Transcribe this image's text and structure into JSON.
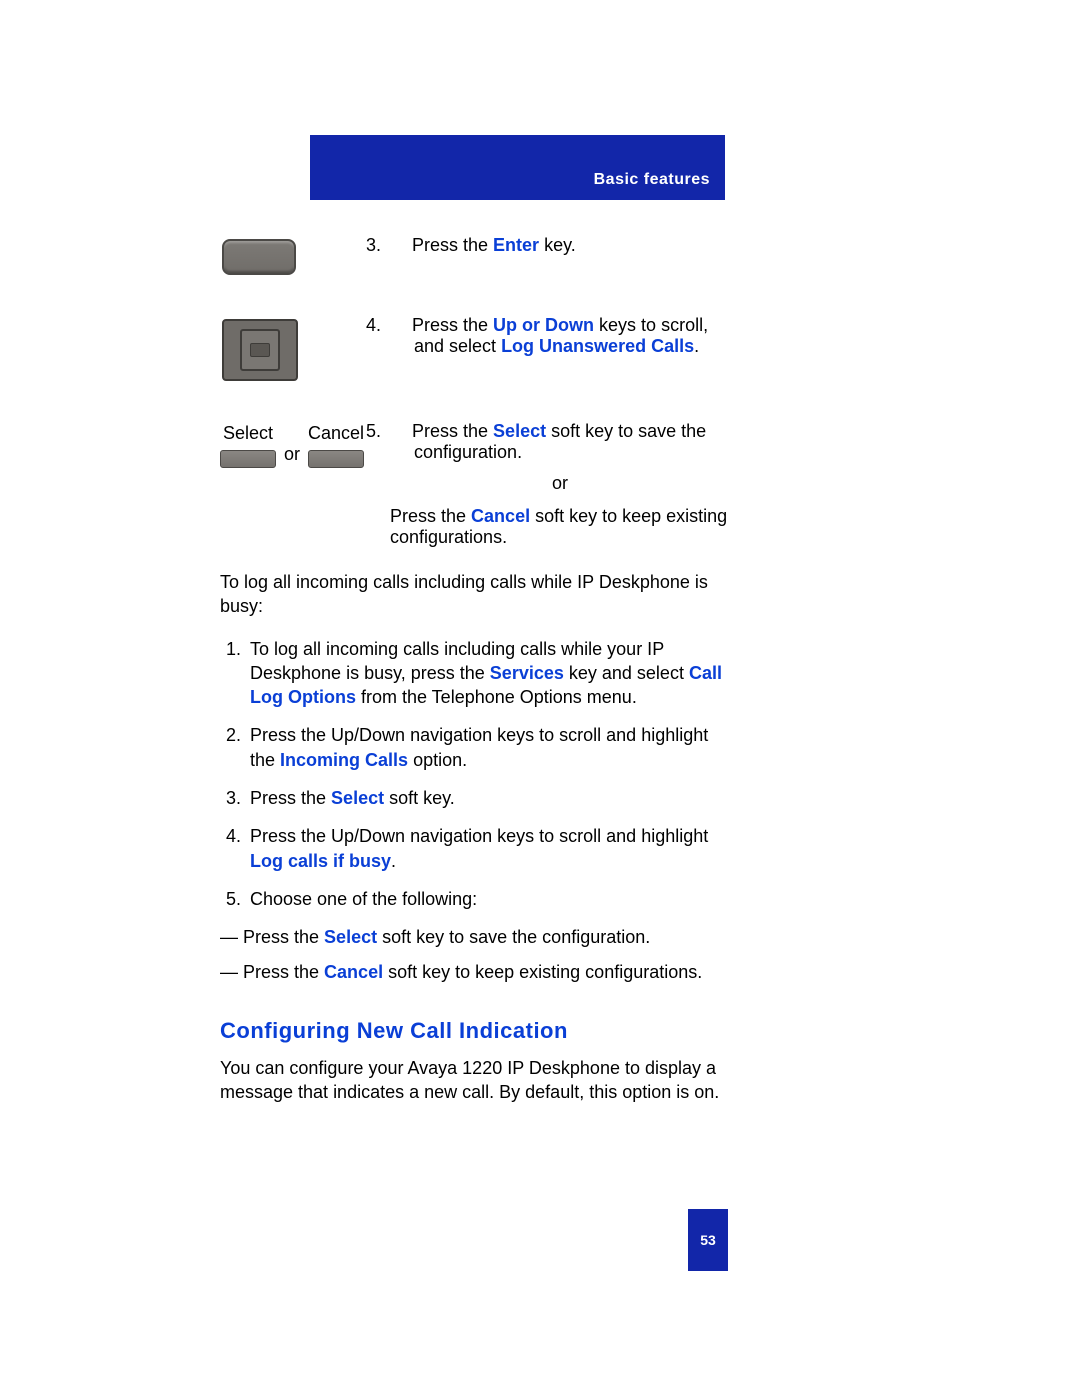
{
  "header": {
    "section": "Basic features"
  },
  "steps_top": {
    "s3": {
      "num": "3.",
      "t1": "Press the ",
      "k1": "Enter",
      "t2": " key."
    },
    "s4": {
      "num": "4.",
      "t1": "Press the ",
      "k1": "Up or Down",
      "t2": " keys to scroll, and select ",
      "k2": "Log Unanswered Calls",
      "t3": "."
    },
    "s5": {
      "num": "5.",
      "t1": "Press the ",
      "k1": "Select",
      "t2": " soft key to save the configuration.",
      "or": "or",
      "t3": "Press the ",
      "k2": "Cancel",
      "t4": " soft key to keep existing configurations."
    }
  },
  "softrow": {
    "select": "Select",
    "cancel": "Cancel",
    "or": "or"
  },
  "intro2": "To log all incoming calls including calls while IP Deskphone is busy:",
  "list2": {
    "i1": {
      "t1": "To log all incoming calls including calls while your IP Deskphone is busy, press the ",
      "k1": "Services",
      "t2": " key and select ",
      "k2": "Call Log Options",
      "t3": " from the Telephone Options menu."
    },
    "i2": {
      "t1": "Press the Up/Down navigation keys to scroll and highlight the ",
      "k1": "Incoming Calls",
      "t2": " option."
    },
    "i3": {
      "t1": "Press the ",
      "k1": "Select",
      "t2": " soft key."
    },
    "i4": {
      "t1": "Press the Up/Down navigation keys to scroll and highlight ",
      "k1": "Log calls if busy",
      "t2": "."
    },
    "i5": {
      "t1": "Choose one of the following:"
    }
  },
  "dashes": {
    "d1": {
      "pre": "— Press the ",
      "k": "Select",
      "post": " soft key to save the configuration."
    },
    "d2": {
      "pre": "— Press the ",
      "k": "Cancel",
      "post": " soft key to keep existing configurations."
    }
  },
  "section2": {
    "title": "Configuring New Call Indication",
    "body": "You can configure your Avaya 1220 IP Deskphone to display a message that indicates a new call. By default, this option is on."
  },
  "page_number": "53"
}
